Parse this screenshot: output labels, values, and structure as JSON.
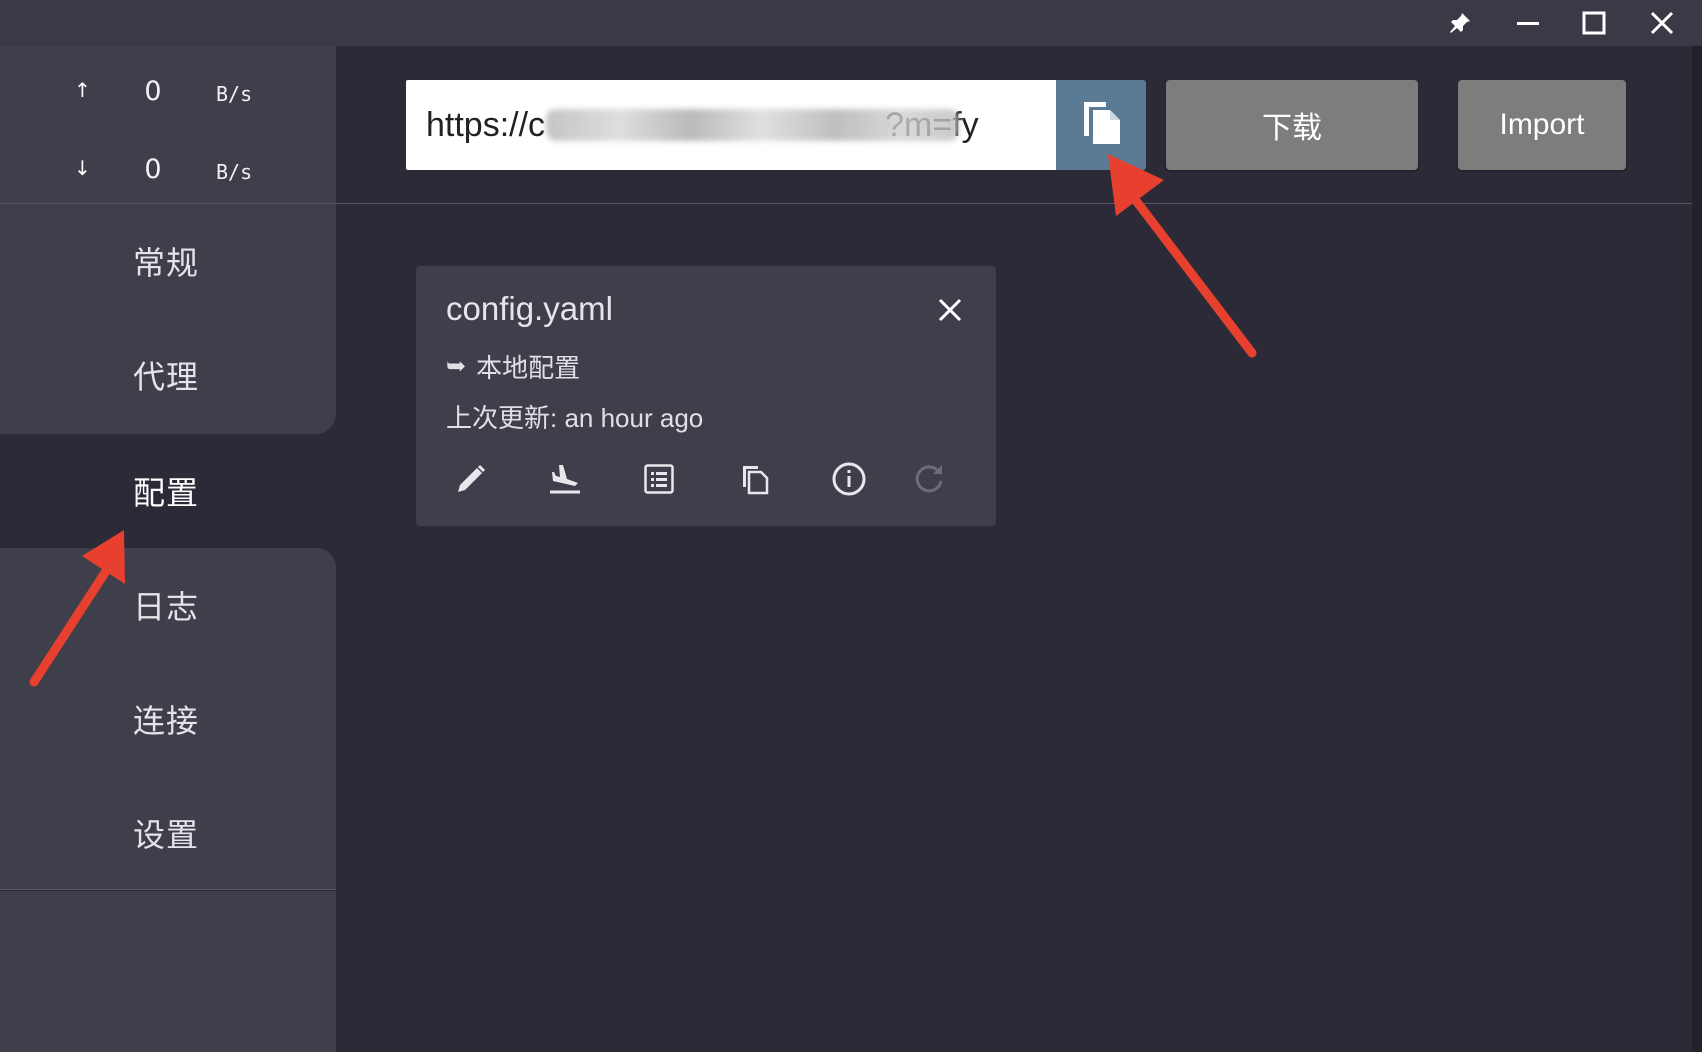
{
  "window": {
    "controls": [
      {
        "name": "pin-icon"
      },
      {
        "name": "minimize-icon"
      },
      {
        "name": "maximize-icon"
      },
      {
        "name": "close-icon"
      }
    ]
  },
  "traffic": {
    "upload": {
      "arrow": "↑",
      "value": "0",
      "unit": "B/s"
    },
    "download": {
      "arrow": "↓",
      "value": "0",
      "unit": "B/s"
    }
  },
  "sidebar": {
    "items": [
      {
        "label": "常规"
      },
      {
        "label": "代理"
      },
      {
        "label": "配置",
        "active": true
      },
      {
        "label": "日志"
      },
      {
        "label": "连接"
      },
      {
        "label": "设置"
      }
    ]
  },
  "toolbar": {
    "url_value": "https://c                                    ?m=fy",
    "paste_icon": "paste-icon",
    "download_label": "下载",
    "import_label": "Import"
  },
  "profile": {
    "name": "config.yaml",
    "type_arrow": "➥",
    "type": "本地配置",
    "updated": "上次更新: an hour ago",
    "actions": [
      "edit-icon",
      "parse-icon",
      "rules-icon",
      "copy-icon",
      "info-icon",
      "refresh-icon"
    ]
  },
  "colors": {
    "background": "#2c2a37",
    "sidebar_panel": "#3f3e4b",
    "titlebar": "#3a3946",
    "paste_button": "#5b7a93",
    "grey_button": "#7f7c7c",
    "annotation_arrow": "#e8402f"
  }
}
